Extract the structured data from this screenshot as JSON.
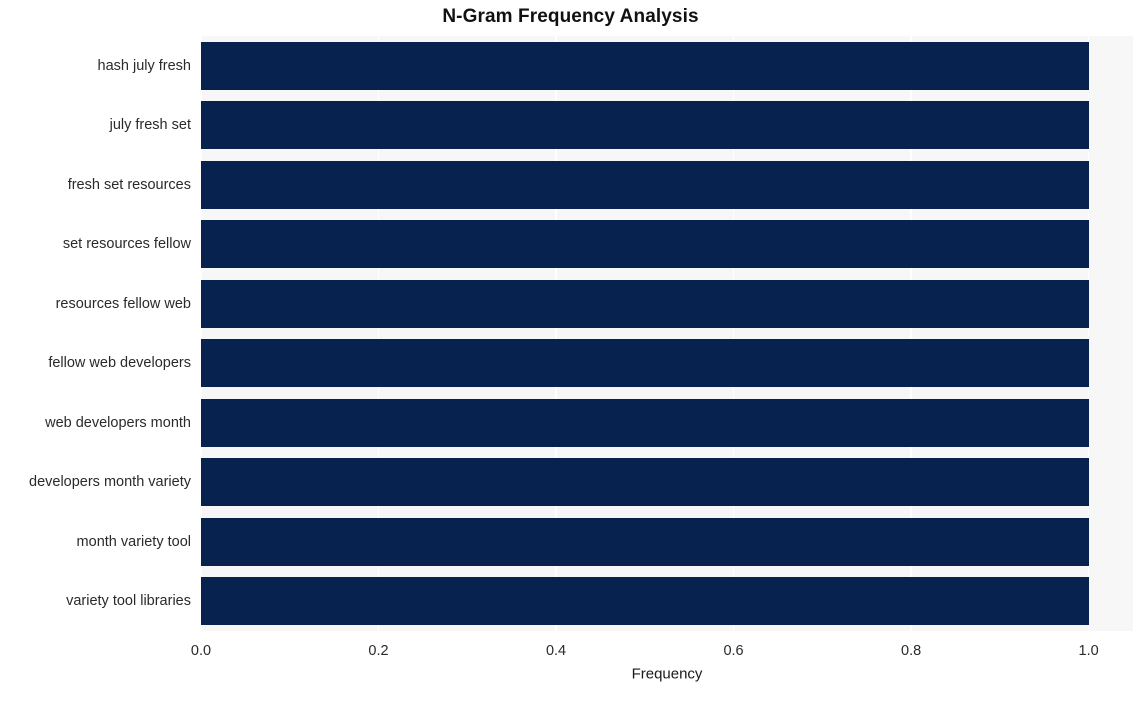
{
  "chart_data": {
    "type": "bar",
    "orientation": "horizontal",
    "title": "N-Gram Frequency Analysis",
    "xlabel": "Frequency",
    "ylabel": "",
    "categories": [
      "hash july fresh",
      "july fresh set",
      "fresh set resources",
      "set resources fellow",
      "resources fellow web",
      "fellow web developers",
      "web developers month",
      "developers month variety",
      "month variety tool",
      "variety tool libraries"
    ],
    "values": [
      1.0,
      1.0,
      1.0,
      1.0,
      1.0,
      1.0,
      1.0,
      1.0,
      1.0,
      1.0
    ],
    "xlim": [
      0.0,
      1.05
    ],
    "xticks": [
      0.0,
      0.2,
      0.4,
      0.6,
      0.8,
      1.0
    ],
    "xtick_labels": [
      "0.0",
      "0.2",
      "0.4",
      "0.6",
      "0.8",
      "1.0"
    ],
    "grid": true,
    "grid_axis": "x",
    "legend": null,
    "colors": {
      "bar": "#07224f",
      "plot_background": "#f7f7f7",
      "figure_background": "#ffffff",
      "gridline": "#ffffff",
      "tick_text": "#2a2a2a",
      "title_text": "#111111"
    }
  }
}
